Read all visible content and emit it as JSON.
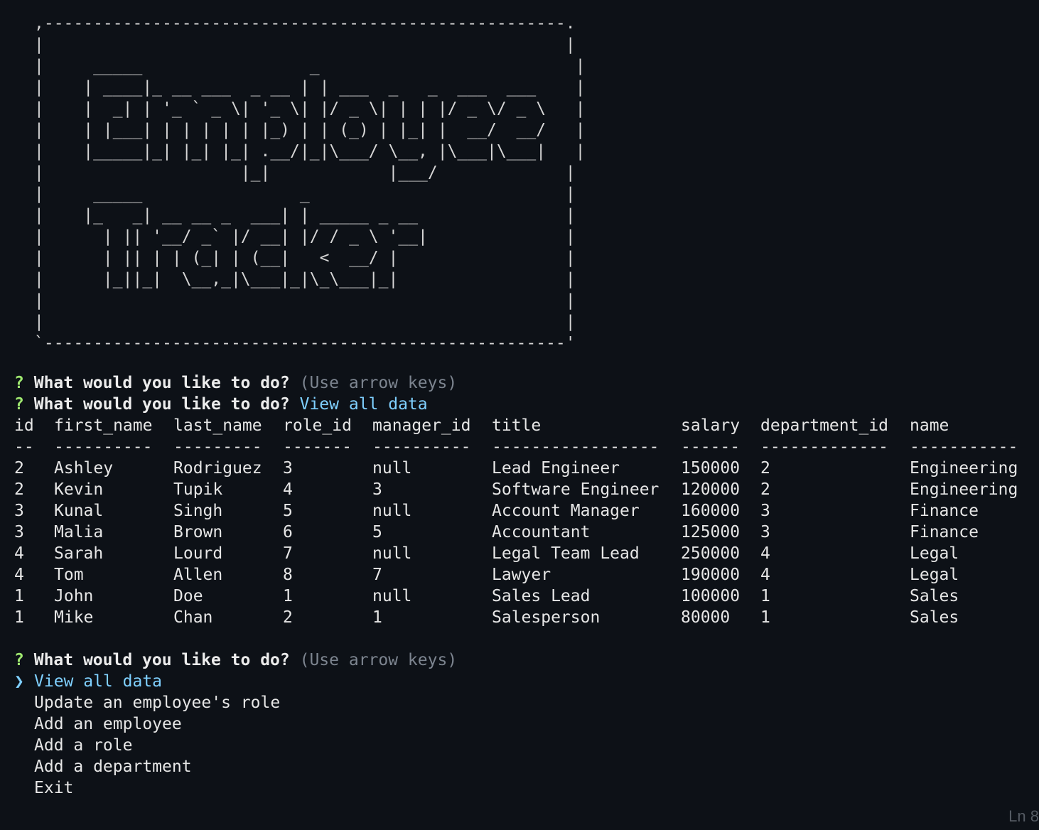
{
  "banner": {
    "art": ",-----------------------------------------------------.\n|                                                     |\n|     _____                 _                          |\n|    | ____|_ __ ___  _ __ | | ___  _   _  ___  ___    |\n|    |  _| | '_ ` _ \\| '_ \\| |/ _ \\| | | |/ _ \\/ _ \\   |\n|    | |___| | | | | | |_) | | (_) | |_| |  __/  __/   |\n|    |_____|_| |_| |_| .__/|_|\\___/ \\__, |\\___|\\___|   |\n|                    |_|            |___/             |\n|     _____                _                          |\n|    |_   _| __ __ _  ___| | _____ _ __               |\n|      | || '__/ _` |/ __| |/ / _ \\ '__|              |\n|      | || | | (_| | (__|   <  __/ |                 |\n|      |_||_|  \\__,_|\\___|_|\\_\\___|_|                 |\n|                                                     |\n|                                                     |\n`-----------------------------------------------------'"
  },
  "prompt1": {
    "mark": "?",
    "question": "What would you like to do?",
    "hint": "(Use arrow keys)"
  },
  "prompt2": {
    "mark": "?",
    "question": "What would you like to do?",
    "answer": "View all data"
  },
  "table": {
    "headers": [
      "id",
      "first_name",
      "last_name",
      "role_id",
      "manager_id",
      "title",
      "salary",
      "department_id",
      "name"
    ],
    "separators": [
      "--",
      "----------",
      "---------",
      "-------",
      "----------",
      "-----------------",
      "------",
      "-------------",
      "-----------"
    ],
    "rows": [
      [
        "2",
        "Ashley",
        "Rodriguez",
        "3",
        "null",
        "Lead Engineer",
        "150000",
        "2",
        "Engineering"
      ],
      [
        "2",
        "Kevin",
        "Tupik",
        "4",
        "3",
        "Software Engineer",
        "120000",
        "2",
        "Engineering"
      ],
      [
        "3",
        "Kunal",
        "Singh",
        "5",
        "null",
        "Account Manager",
        "160000",
        "3",
        "Finance"
      ],
      [
        "3",
        "Malia",
        "Brown",
        "6",
        "5",
        "Accountant",
        "125000",
        "3",
        "Finance"
      ],
      [
        "4",
        "Sarah",
        "Lourd",
        "7",
        "null",
        "Legal Team Lead",
        "250000",
        "4",
        "Legal"
      ],
      [
        "4",
        "Tom",
        "Allen",
        "8",
        "7",
        "Lawyer",
        "190000",
        "4",
        "Legal"
      ],
      [
        "1",
        "John",
        "Doe",
        "1",
        "null",
        "Sales Lead",
        "100000",
        "1",
        "Sales"
      ],
      [
        "1",
        "Mike",
        "Chan",
        "2",
        "1",
        "Salesperson",
        "80000",
        "1",
        "Sales"
      ]
    ]
  },
  "prompt3": {
    "mark": "?",
    "question": "What would you like to do?",
    "hint": "(Use arrow keys)"
  },
  "menu": {
    "pointer": "❯",
    "items": [
      "View all data",
      "Update an employee's role",
      "Add an employee",
      "Add a role",
      "Add a department",
      "Exit"
    ],
    "selected_index": 0
  },
  "status": {
    "text": "Ln 8"
  },
  "colors": {
    "background": "#0d1117",
    "question_mark": "#9fe870",
    "answer": "#7fd0ff",
    "hint": "#7d8590"
  }
}
